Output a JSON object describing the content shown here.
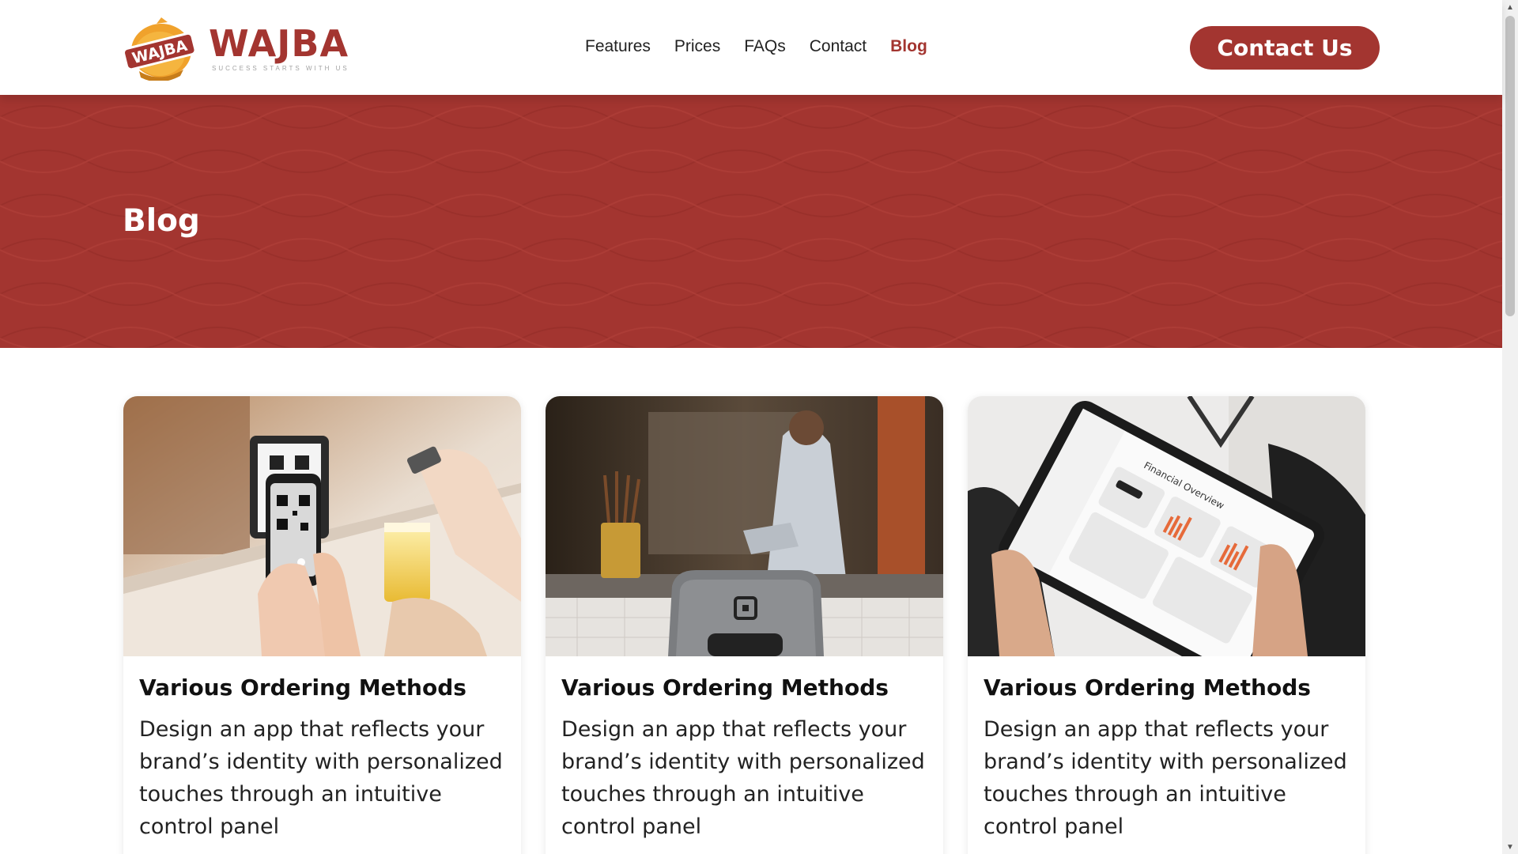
{
  "brand": {
    "badge_text": "WAJBA",
    "name": "WAJBA",
    "tagline": "SUCCESS STARTS WITH US",
    "color": "#a33530"
  },
  "nav": {
    "items": [
      {
        "label": "Features",
        "active": false
      },
      {
        "label": "Prices",
        "active": false
      },
      {
        "label": "FAQs",
        "active": false
      },
      {
        "label": "Contact",
        "active": false
      },
      {
        "label": "Blog",
        "active": true
      }
    ]
  },
  "header": {
    "cta_label": "Contact Us"
  },
  "hero": {
    "title": "Blog",
    "background_color": "#a33530"
  },
  "cards": [
    {
      "image": "qr-code-ordering-photo",
      "title": "Various Ordering Methods",
      "text": "Design an app that reflects your brand’s identity with personalized touches through an intuitive control panel"
    },
    {
      "image": "pos-terminal-counter-photo",
      "title": "Various Ordering Methods",
      "text": "Design an app that reflects your brand’s identity with personalized touches through an intuitive control panel"
    },
    {
      "image": "tablet-dashboard-photo",
      "title": "Various Ordering Methods",
      "text": "Design an app that reflects your brand’s identity with personalized touches through an intuitive control panel"
    }
  ],
  "photo_text": {
    "dashboard_heading": "Financial Overview"
  }
}
